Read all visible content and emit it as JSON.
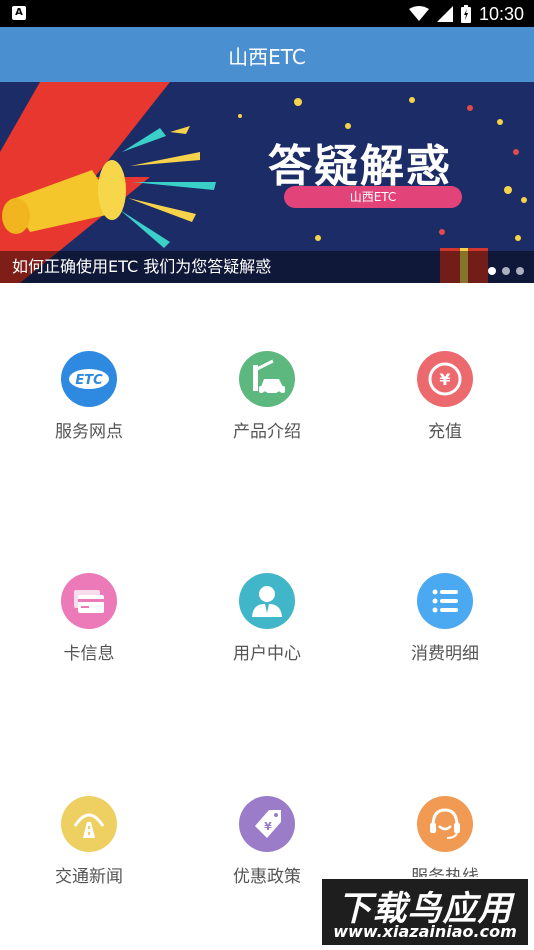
{
  "status_bar": {
    "time": "10:30",
    "notification_glyph": "A"
  },
  "header": {
    "title": "山西ETC"
  },
  "banner": {
    "headline": "答疑解惑",
    "pill": "山西ETC",
    "caption": "如何正确使用ETC 我们为您答疑解惑",
    "active_dot": 0,
    "dot_count": 3
  },
  "grid": [
    {
      "label": "服务网点",
      "icon": "etc-icon",
      "color": "#2d8ae0",
      "icon_text": "ETC"
    },
    {
      "label": "产品介绍",
      "icon": "toll-car-icon",
      "color": "#5db87f"
    },
    {
      "label": "充值",
      "icon": "yen-coin-icon",
      "color": "#ec6a6d",
      "icon_text": "¥"
    },
    {
      "label": "卡信息",
      "icon": "card-icon",
      "color": "#ec79b8"
    },
    {
      "label": "用户中心",
      "icon": "user-icon",
      "color": "#41b6c8"
    },
    {
      "label": "消费明细",
      "icon": "list-icon",
      "color": "#4aa9f0"
    },
    {
      "label": "交通新闻",
      "icon": "road-icon",
      "color": "#eecf62"
    },
    {
      "label": "优惠政策",
      "icon": "discount-tag-icon",
      "color": "#9a7cc9",
      "icon_text": "¥"
    },
    {
      "label": "服务热线",
      "icon": "headset-icon",
      "color": "#f19a53"
    }
  ],
  "watermark": {
    "line1": "下载鸟应用",
    "line2": "www.xiazainiao.com"
  }
}
